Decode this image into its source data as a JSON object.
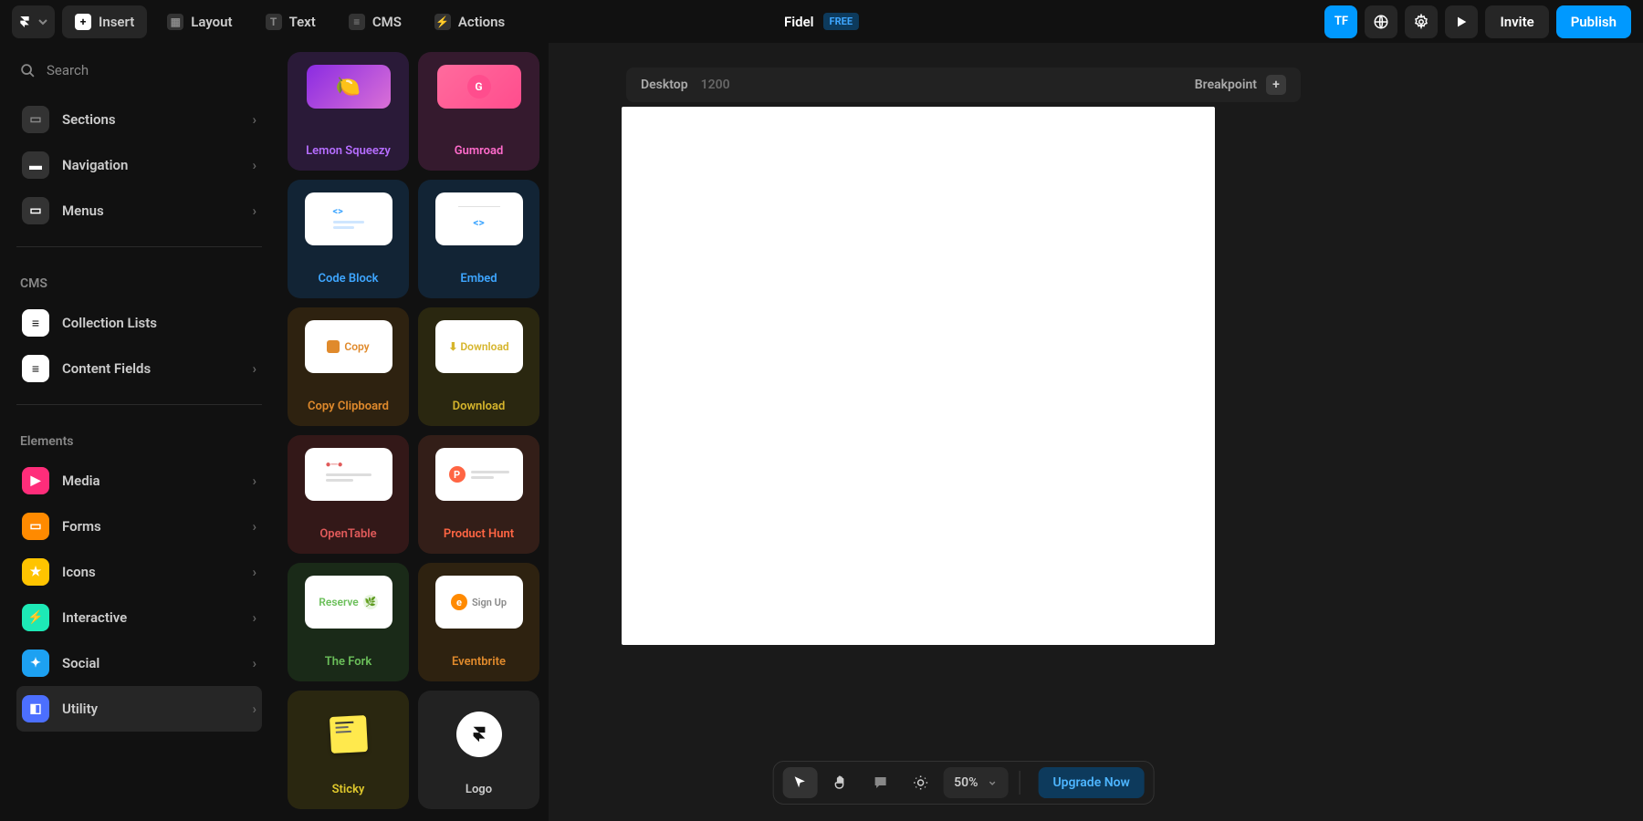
{
  "header": {
    "toolbar": [
      {
        "id": "insert",
        "label": "Insert",
        "active": true
      },
      {
        "id": "layout",
        "label": "Layout"
      },
      {
        "id": "text",
        "label": "Text"
      },
      {
        "id": "cms",
        "label": "CMS"
      },
      {
        "id": "actions",
        "label": "Actions"
      }
    ],
    "project_name": "Fidel",
    "plan_badge": "FREE",
    "avatar_initials": "TF",
    "invite": "Invite",
    "publish": "Publish"
  },
  "sidebar": {
    "search_placeholder": "Search",
    "groups": [
      {
        "items": [
          {
            "id": "sections",
            "label": "Sections",
            "icon_bg": "#333",
            "icon_color": "#888"
          },
          {
            "id": "navigation",
            "label": "Navigation",
            "icon_bg": "#333",
            "icon_color": "#fff"
          },
          {
            "id": "menus",
            "label": "Menus",
            "icon_bg": "#333",
            "icon_color": "#fff"
          }
        ]
      },
      {
        "title": "CMS",
        "items": [
          {
            "id": "collection-lists",
            "label": "Collection Lists",
            "icon_bg": "#fff",
            "icon_color": "#111",
            "no_chevron": true
          },
          {
            "id": "content-fields",
            "label": "Content Fields",
            "icon_bg": "#fff",
            "icon_color": "#111"
          }
        ]
      },
      {
        "title": "Elements",
        "items": [
          {
            "id": "media",
            "label": "Media",
            "icon_bg": "#ff2d7a",
            "icon_color": "#fff"
          },
          {
            "id": "forms",
            "label": "Forms",
            "icon_bg": "#ff8a00",
            "icon_color": "#fff"
          },
          {
            "id": "icons",
            "label": "Icons",
            "icon_bg": "#ffc400",
            "icon_color": "#fff"
          },
          {
            "id": "interactive",
            "label": "Interactive",
            "icon_bg": "#1de9b6",
            "icon_color": "#fff"
          },
          {
            "id": "social",
            "label": "Social",
            "icon_bg": "#1da1f2",
            "icon_color": "#fff"
          },
          {
            "id": "utility",
            "label": "Utility",
            "icon_bg": "#4c6fff",
            "icon_color": "#fff",
            "active": true
          }
        ]
      }
    ]
  },
  "insert_panel": {
    "cards": [
      {
        "id": "lemon-squeezy",
        "label": "Lemon Squeezy",
        "bg": "#2a1a38",
        "text": "#b56dff",
        "thumb_bg": "linear-gradient(135deg,#8a2be2,#da70d6)"
      },
      {
        "id": "gumroad",
        "label": "Gumroad",
        "bg": "#351a2e",
        "text": "#ff6bcb",
        "thumb_bg": "linear-gradient(135deg,#ff6b9d,#ff4d8d)"
      },
      {
        "id": "code-block",
        "label": "Code Block",
        "bg": "#122435",
        "text": "#3ea6ff",
        "thumb_bg": "#fff"
      },
      {
        "id": "embed",
        "label": "Embed",
        "bg": "#122435",
        "text": "#3ea6ff",
        "thumb_bg": "#fff"
      },
      {
        "id": "copy-clipboard",
        "label": "Copy Clipboard",
        "bg": "#2e2210",
        "text": "#e08a2c",
        "thumb_bg": "#fff",
        "thumb_label": "Copy"
      },
      {
        "id": "download",
        "label": "Download",
        "bg": "#2a2710",
        "text": "#d6b52c",
        "thumb_bg": "#fff",
        "thumb_label": "Download"
      },
      {
        "id": "opentable",
        "label": "OpenTable",
        "bg": "#331818",
        "text": "#e05a5a",
        "thumb_bg": "#fff"
      },
      {
        "id": "product-hunt",
        "label": "Product Hunt",
        "bg": "#331e18",
        "text": "#ff6543",
        "thumb_bg": "#fff"
      },
      {
        "id": "the-fork",
        "label": "The Fork",
        "bg": "#1a2a18",
        "text": "#6bbf5a",
        "thumb_bg": "#fff",
        "thumb_label": "Reserve"
      },
      {
        "id": "eventbrite",
        "label": "Eventbrite",
        "bg": "#2e2210",
        "text": "#e08a2c",
        "thumb_bg": "#fff",
        "thumb_label": "Sign Up"
      },
      {
        "id": "sticky",
        "label": "Sticky",
        "bg": "#2a2710",
        "text": "#e0c92c",
        "thumb_bg": "#ffe94d"
      },
      {
        "id": "logo",
        "label": "Logo",
        "bg": "#222",
        "text": "#ccc",
        "thumb_bg": "#fff"
      }
    ]
  },
  "canvas": {
    "breakpoint_label": "Desktop",
    "breakpoint_value": "1200",
    "breakpoint_action": "Breakpoint"
  },
  "bottom": {
    "zoom": "50%",
    "upgrade": "Upgrade Now"
  }
}
